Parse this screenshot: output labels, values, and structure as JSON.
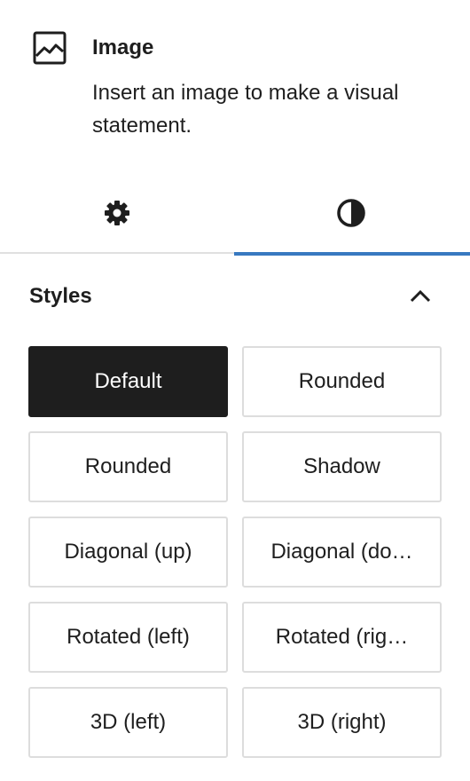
{
  "block": {
    "icon": "image-icon",
    "title": "Image",
    "description": "Insert an image to make a visual statement."
  },
  "tabs": [
    {
      "name": "settings",
      "icon": "gear-icon",
      "active": false
    },
    {
      "name": "styles",
      "icon": "contrast-icon",
      "active": true
    }
  ],
  "styles_panel": {
    "title": "Styles",
    "toggle_icon": "chevron-up-icon",
    "expanded": true,
    "options": [
      {
        "label": "Default",
        "selected": true
      },
      {
        "label": "Rounded",
        "selected": false
      },
      {
        "label": "Rounded",
        "selected": false
      },
      {
        "label": "Shadow",
        "selected": false
      },
      {
        "label": "Diagonal (up)",
        "selected": false
      },
      {
        "label": "Diagonal (do…",
        "selected": false
      },
      {
        "label": "Rotated (left)",
        "selected": false
      },
      {
        "label": "Rotated (rig…",
        "selected": false
      },
      {
        "label": "3D (left)",
        "selected": false
      },
      {
        "label": "3D (right)",
        "selected": false
      }
    ]
  },
  "colors": {
    "accent": "#3879c0",
    "selected_bg": "#1e1e1e",
    "border": "#dddddd",
    "text": "#1e1e1e"
  }
}
